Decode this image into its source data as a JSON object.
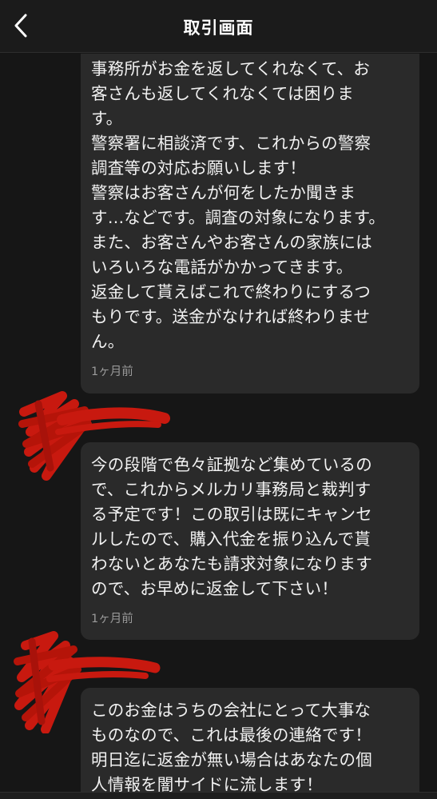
{
  "header": {
    "title": "取引画面",
    "back_icon": "chevron-left-icon"
  },
  "messages": [
    {
      "text": "事務所がお金を返してくれなくて、お\n客さんも返してくれなくては困りま\nす。\n警察署に相談済です、これからの警察\n調査等の対応お願いします！\n警察はお客さんが何をしたか聞きま\nす…などです。調査の対象になります。\nまた、お客さんやお客さんの家族には\nいろいろな電話がかかってきます。\n返金して貰えばこれで終わりにするつ\nもりです。送金がなければ終わりませ\nん。",
      "time": "1ヶ月前"
    },
    {
      "text": "今の段階で色々証拠など集めているの\nで、これからメルカリ事務局と裁判す\nる予定です！この取引は既にキャンセ\nルしたので、購入代金を振り込んで貰\nわないとあなたも請求対象になります\nので、お早めに返金して下さい！",
      "time": "1ヶ月前"
    },
    {
      "text": "このお金はうちの会社にとって大事な\nものなので、これは最後の連絡です！\n明日迄に返金が無い場合はあなたの個\n人情報を闇サイドに流します！",
      "time": ""
    }
  ],
  "colors": {
    "background": "#161616",
    "header_bg": "#1b1b1b",
    "bubble_bg": "#2a2a2a",
    "redaction": "#c8190f"
  }
}
